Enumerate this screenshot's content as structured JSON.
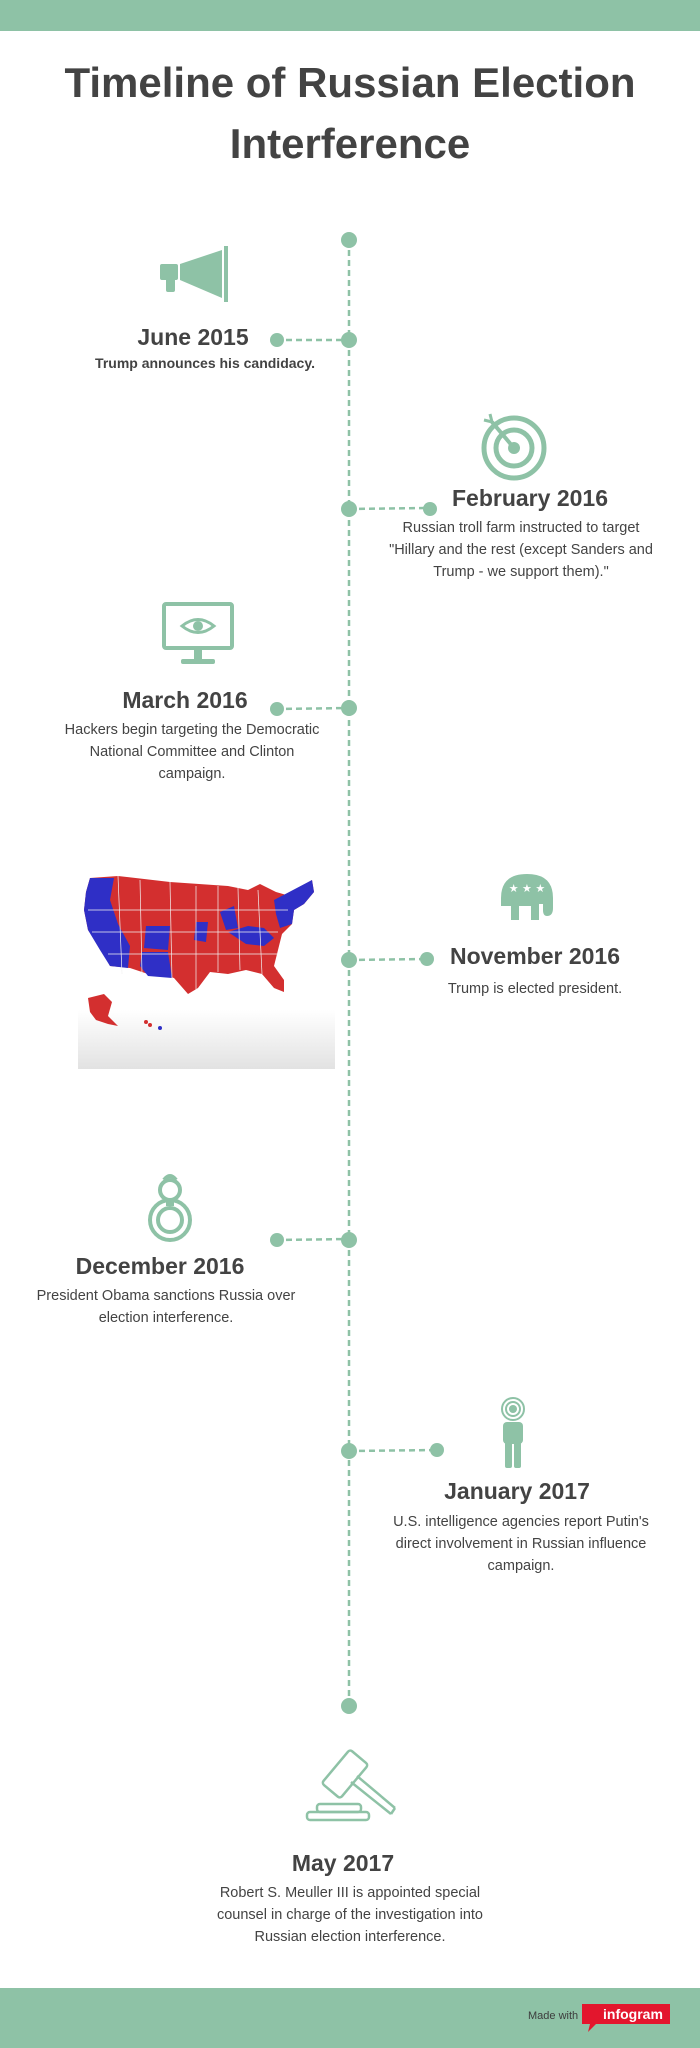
{
  "title_line1": "Timeline of Russian Election",
  "title_line2": "Interference",
  "colors": {
    "accent": "#8ec2a6",
    "text": "#434343",
    "map_red": "#d32f2f",
    "map_blue": "#2f2fc6",
    "brand_red": "#e3162d"
  },
  "events": [
    {
      "date": "June 2015",
      "desc": "Trump announces his candidacy.",
      "icon": "megaphone-icon"
    },
    {
      "date": "February 2016",
      "desc": "Russian troll farm instructed to target \"Hillary and the rest (except Sanders and Trump - we support them).\"",
      "icon": "target-icon"
    },
    {
      "date": "March 2016",
      "desc": "Hackers begin targeting the Democratic National Committee and Clinton campaign.",
      "icon": "monitor-eye-icon"
    },
    {
      "date": "November 2016",
      "desc": "Trump is elected president.",
      "icon": "republican-elephant-icon"
    },
    {
      "date": "December 2016",
      "desc": "President Obama sanctions Russia over election interference.",
      "icon": "handcuffs-icon"
    },
    {
      "date": "January 2017",
      "desc": "U.S. intelligence agencies report Putin's direct involvement in Russian influence campaign.",
      "icon": "spy-person-icon"
    },
    {
      "date": "May 2017",
      "desc": "Robert S. Meuller III is appointed special counsel in charge of the investigation into Russian election interference.",
      "icon": "gavel-icon"
    }
  ],
  "footer": {
    "made_with": "Made with",
    "brand": "infogram"
  }
}
